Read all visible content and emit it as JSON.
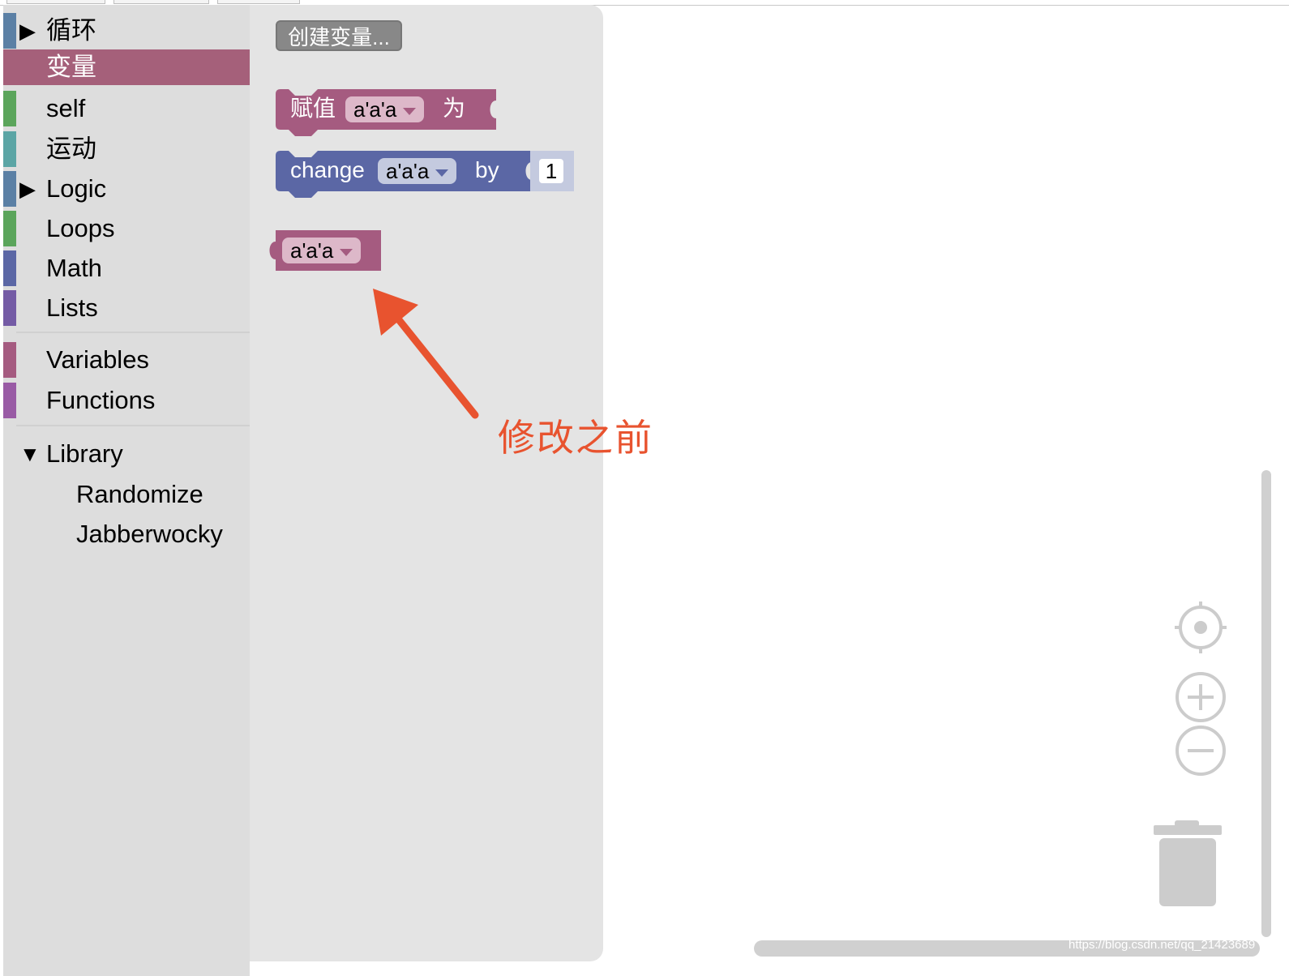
{
  "toolbox": {
    "items": [
      {
        "label": "循环",
        "color": "#5b80a5",
        "arrow": "▶"
      },
      {
        "label": "变量",
        "color": "#a5607a",
        "selected": true
      },
      {
        "label": "self",
        "color": "#5ba55b"
      },
      {
        "label": "运动",
        "color": "#5ba5a5"
      },
      {
        "label": "Logic",
        "color": "#5b80a5",
        "arrow": "▶"
      },
      {
        "label": "Loops",
        "color": "#5ba55b"
      },
      {
        "label": "Math",
        "color": "#5b67a5"
      },
      {
        "label": "Lists",
        "color": "#745ba5"
      },
      {
        "label": "Variables",
        "color": "#a55b80"
      },
      {
        "label": "Functions",
        "color": "#995ba5"
      },
      {
        "label": "Library",
        "arrow": "▼"
      },
      {
        "label": "Randomize"
      },
      {
        "label": "Jabberwocky"
      }
    ]
  },
  "flyout": {
    "create_variable_label": "创建变量...",
    "set_block": {
      "prefix": "赋值",
      "variable": "a'a'a",
      "suffix": "为"
    },
    "change_block": {
      "prefix": "change",
      "variable": "a'a'a",
      "by_label": "by",
      "value": "1"
    },
    "get_block": {
      "variable": "a'a'a"
    }
  },
  "annotation": {
    "text": "修改之前",
    "color": "#e8532f"
  },
  "colors": {
    "variable_block": "#a55b80",
    "math_block": "#5b67a5",
    "toolbox_bg": "#dddddd",
    "flyout_bg": "#e4e4e4"
  },
  "workspace": {
    "controls": [
      "recenter-icon",
      "zoom-in-icon",
      "zoom-out-icon",
      "trash-icon"
    ]
  },
  "watermark": "https://blog.csdn.net/qq_21423689"
}
